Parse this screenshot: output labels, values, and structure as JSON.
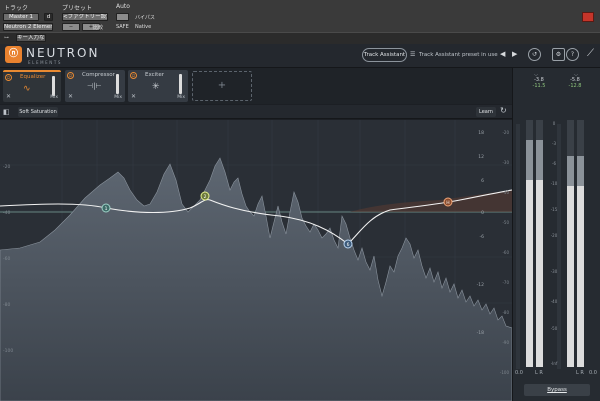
{
  "host": {
    "track_label": "トラック",
    "preset_label": "プリセット",
    "auto_label": "Auto",
    "track_name": "Master 1",
    "track_letter": "d",
    "insert_name": "Neutron 2 Elements",
    "preset_value": "<ファクトリー設定>",
    "compare_label": "比較",
    "safe_label": "SAFE",
    "bypass_label": "バイパス",
    "native_label": "Native",
    "minus": "−",
    "plus": "+",
    "key_input": "キー入力なし"
  },
  "neutron": {
    "logo_glyph": "ⓝ",
    "title": "NEUTRON",
    "subtitle": "ELEMENTS",
    "track_assistant_button": "Track Assistant",
    "track_assistant_status": "Track Assistant preset in use",
    "menu_icon": "hamburger-icon",
    "prev_arrow": "◀",
    "next_arrow": "▶",
    "history_icon": "↺",
    "settings_icon": "⚙",
    "help_icon": "?",
    "brand_icon": "⟋"
  },
  "modules": [
    {
      "name": "Equalizer",
      "active": true,
      "glyph": "∿",
      "mix": "Mix"
    },
    {
      "name": "Compressor",
      "active": false,
      "glyph": "⊣|⊢",
      "mix": "Mix"
    },
    {
      "name": "Exciter",
      "active": false,
      "glyph": "✳",
      "mix": "Mix"
    }
  ],
  "add_module": "+",
  "toolbar": {
    "preset_name": "Soft Saturation",
    "learn_label": "Learn"
  },
  "eq_nodes": [
    "1",
    "2",
    "6",
    "H"
  ],
  "graph_scale_left": [
    "-20",
    "-40",
    "-60",
    "-80",
    "-100"
  ],
  "graph_scale_right_db": [
    "18",
    "12",
    "6",
    "0",
    "-6",
    "-12",
    "-18"
  ],
  "graph_scale_right2": [
    "-20",
    "-30",
    "-40",
    "-50",
    "-60",
    "-70",
    "-80",
    "-90",
    "-100"
  ],
  "meters": {
    "in_peak": "-3.8",
    "in_rms": "-11.5",
    "out_peak": "-5.8",
    "out_rms": "-12.8",
    "scale": [
      "0",
      "-3",
      "-6",
      "-10",
      "-15",
      "-20",
      "-30",
      "-40",
      "-50",
      "-Inf"
    ],
    "in_label": "L R",
    "out_label": "L R",
    "bottom_left": "0.0",
    "bottom_right": "0.0",
    "bypass": "Bypass"
  },
  "colors": {
    "accent": "#e98a32",
    "meter_fill": "#d8d8d8",
    "readout_green": "#8ec57c"
  }
}
